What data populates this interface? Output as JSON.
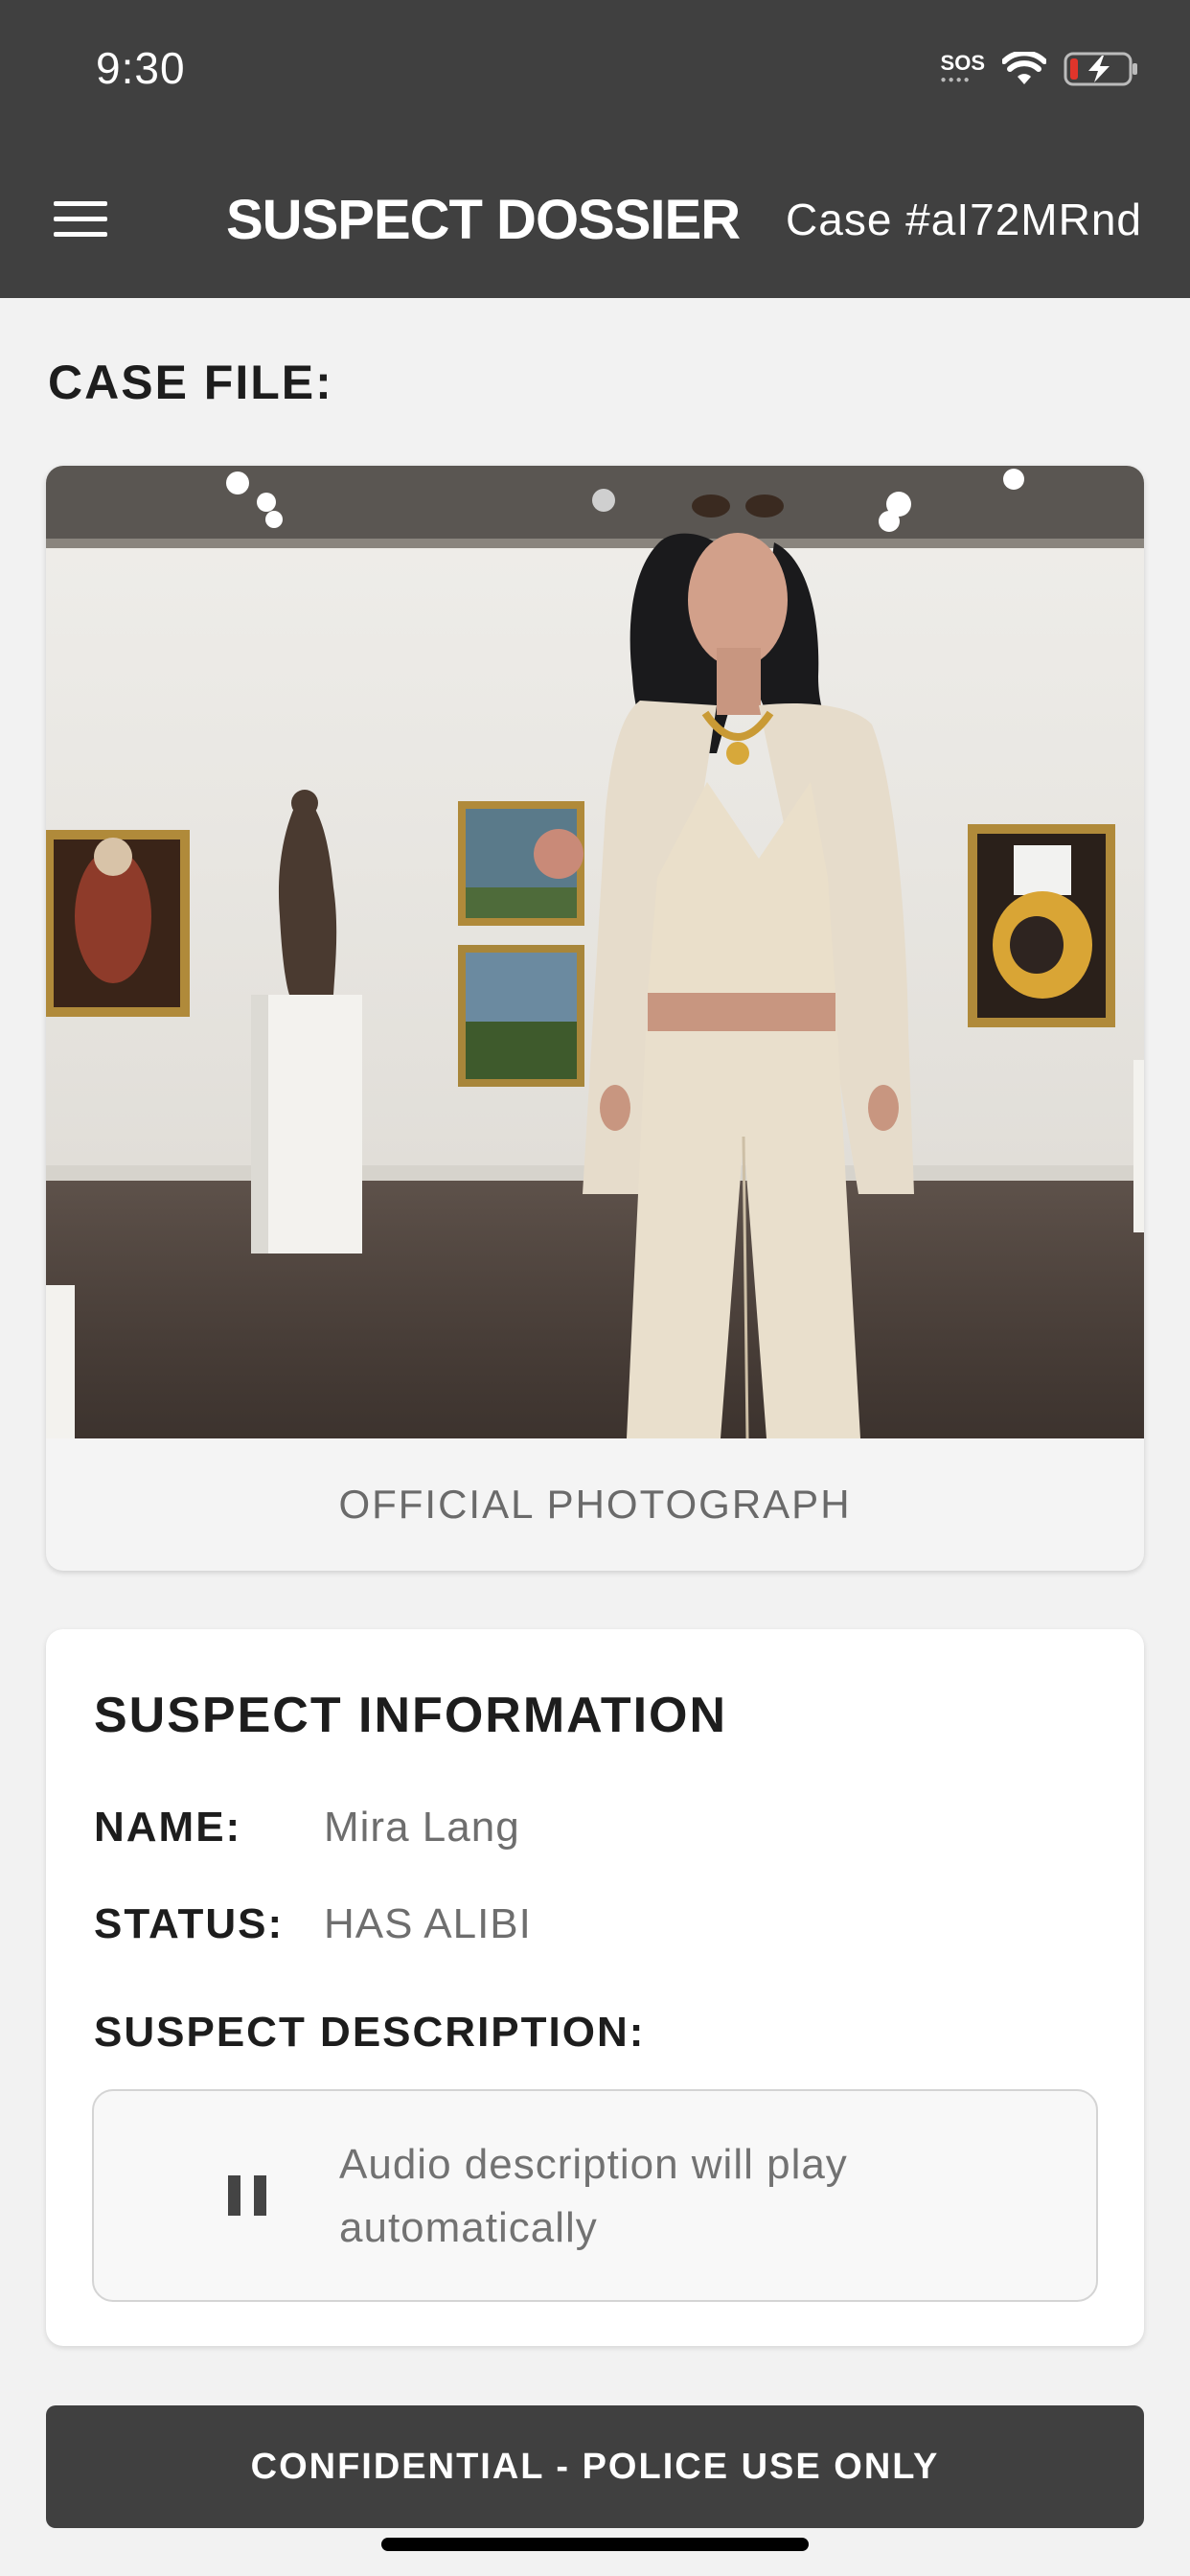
{
  "status_bar": {
    "time": "9:30",
    "sos": "SOS"
  },
  "header": {
    "title": "SUSPECT DOSSIER",
    "case_number": "Case #aI72MRnd"
  },
  "case_file": {
    "heading": "CASE FILE:",
    "photo_caption": "OFFICIAL PHOTOGRAPH"
  },
  "suspect_info": {
    "heading": "SUSPECT INFORMATION",
    "name_label": "NAME:",
    "name_value": "Mira Lang",
    "status_label": "STATUS:",
    "status_value": "HAS ALIBI",
    "description_label": "SUSPECT DESCRIPTION:",
    "audio_text": "Audio description will play automatically"
  },
  "footer": {
    "banner": "CONFIDENTIAL - POLICE USE ONLY"
  },
  "colors": {
    "header_bg": "#404040",
    "page_bg": "#f2f2f2",
    "card_bg": "#ffffff",
    "label": "#1d1d1d",
    "value": "#6e6e6e"
  },
  "icons": [
    "menu-icon",
    "wifi-icon",
    "battery-charging-icon",
    "pause-icon"
  ]
}
